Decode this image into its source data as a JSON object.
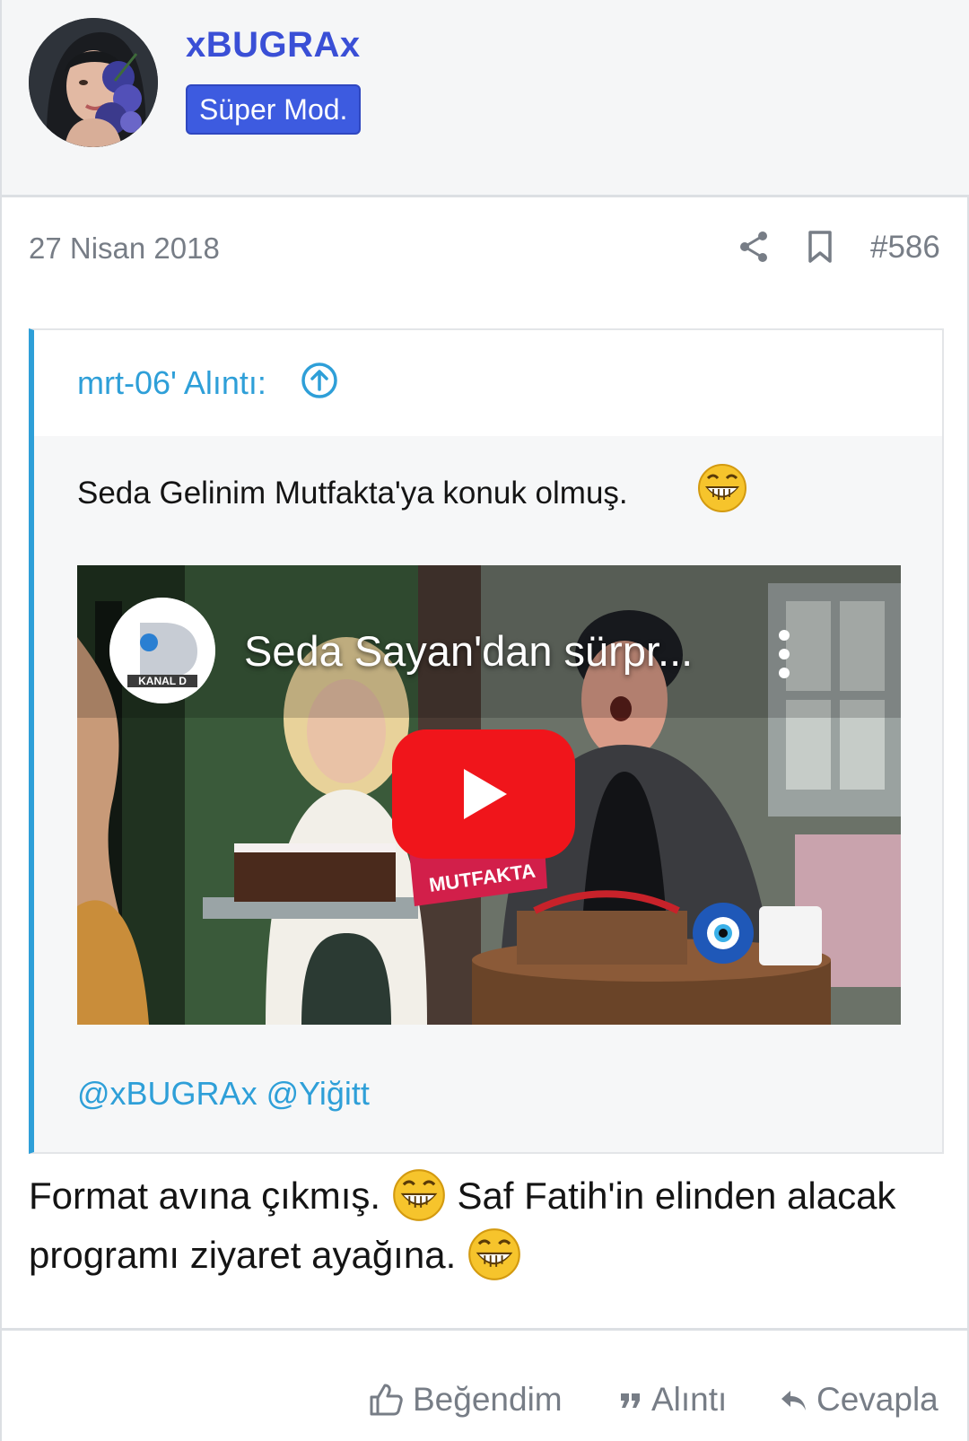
{
  "user": {
    "name": "xBUGRAx",
    "role": "Süper Mod."
  },
  "post": {
    "date": "27 Nisan 2018",
    "number": "#586",
    "icons": {
      "share": "share-icon",
      "bookmark": "bookmark-icon"
    },
    "body_parts": [
      "Format avına çıkmış.",
      "Saf Fatih'in elinden alacak programı ziyaret ayağına."
    ],
    "emoji": "grinning-emoji"
  },
  "quote": {
    "author_label": "mrt-06' Alıntı:",
    "text": "Seda Gelinim Mutfakta'ya konuk olmuş.",
    "video": {
      "title": "Seda Sayan'dan sürpr...",
      "channel": "KANAL D",
      "show_logo_text": "MUTFAKTA"
    },
    "mentions": [
      "@xBUGRAx",
      "@Yiğitt"
    ]
  },
  "footer": {
    "like_label": "Beğendim",
    "quote_label": "Alıntı",
    "reply_label": "Cevapla"
  },
  "colors": {
    "username": "#3a4fd6",
    "badge": "#3d5be0",
    "quote_accent": "#2e9fd8",
    "muted": "#777d86"
  }
}
